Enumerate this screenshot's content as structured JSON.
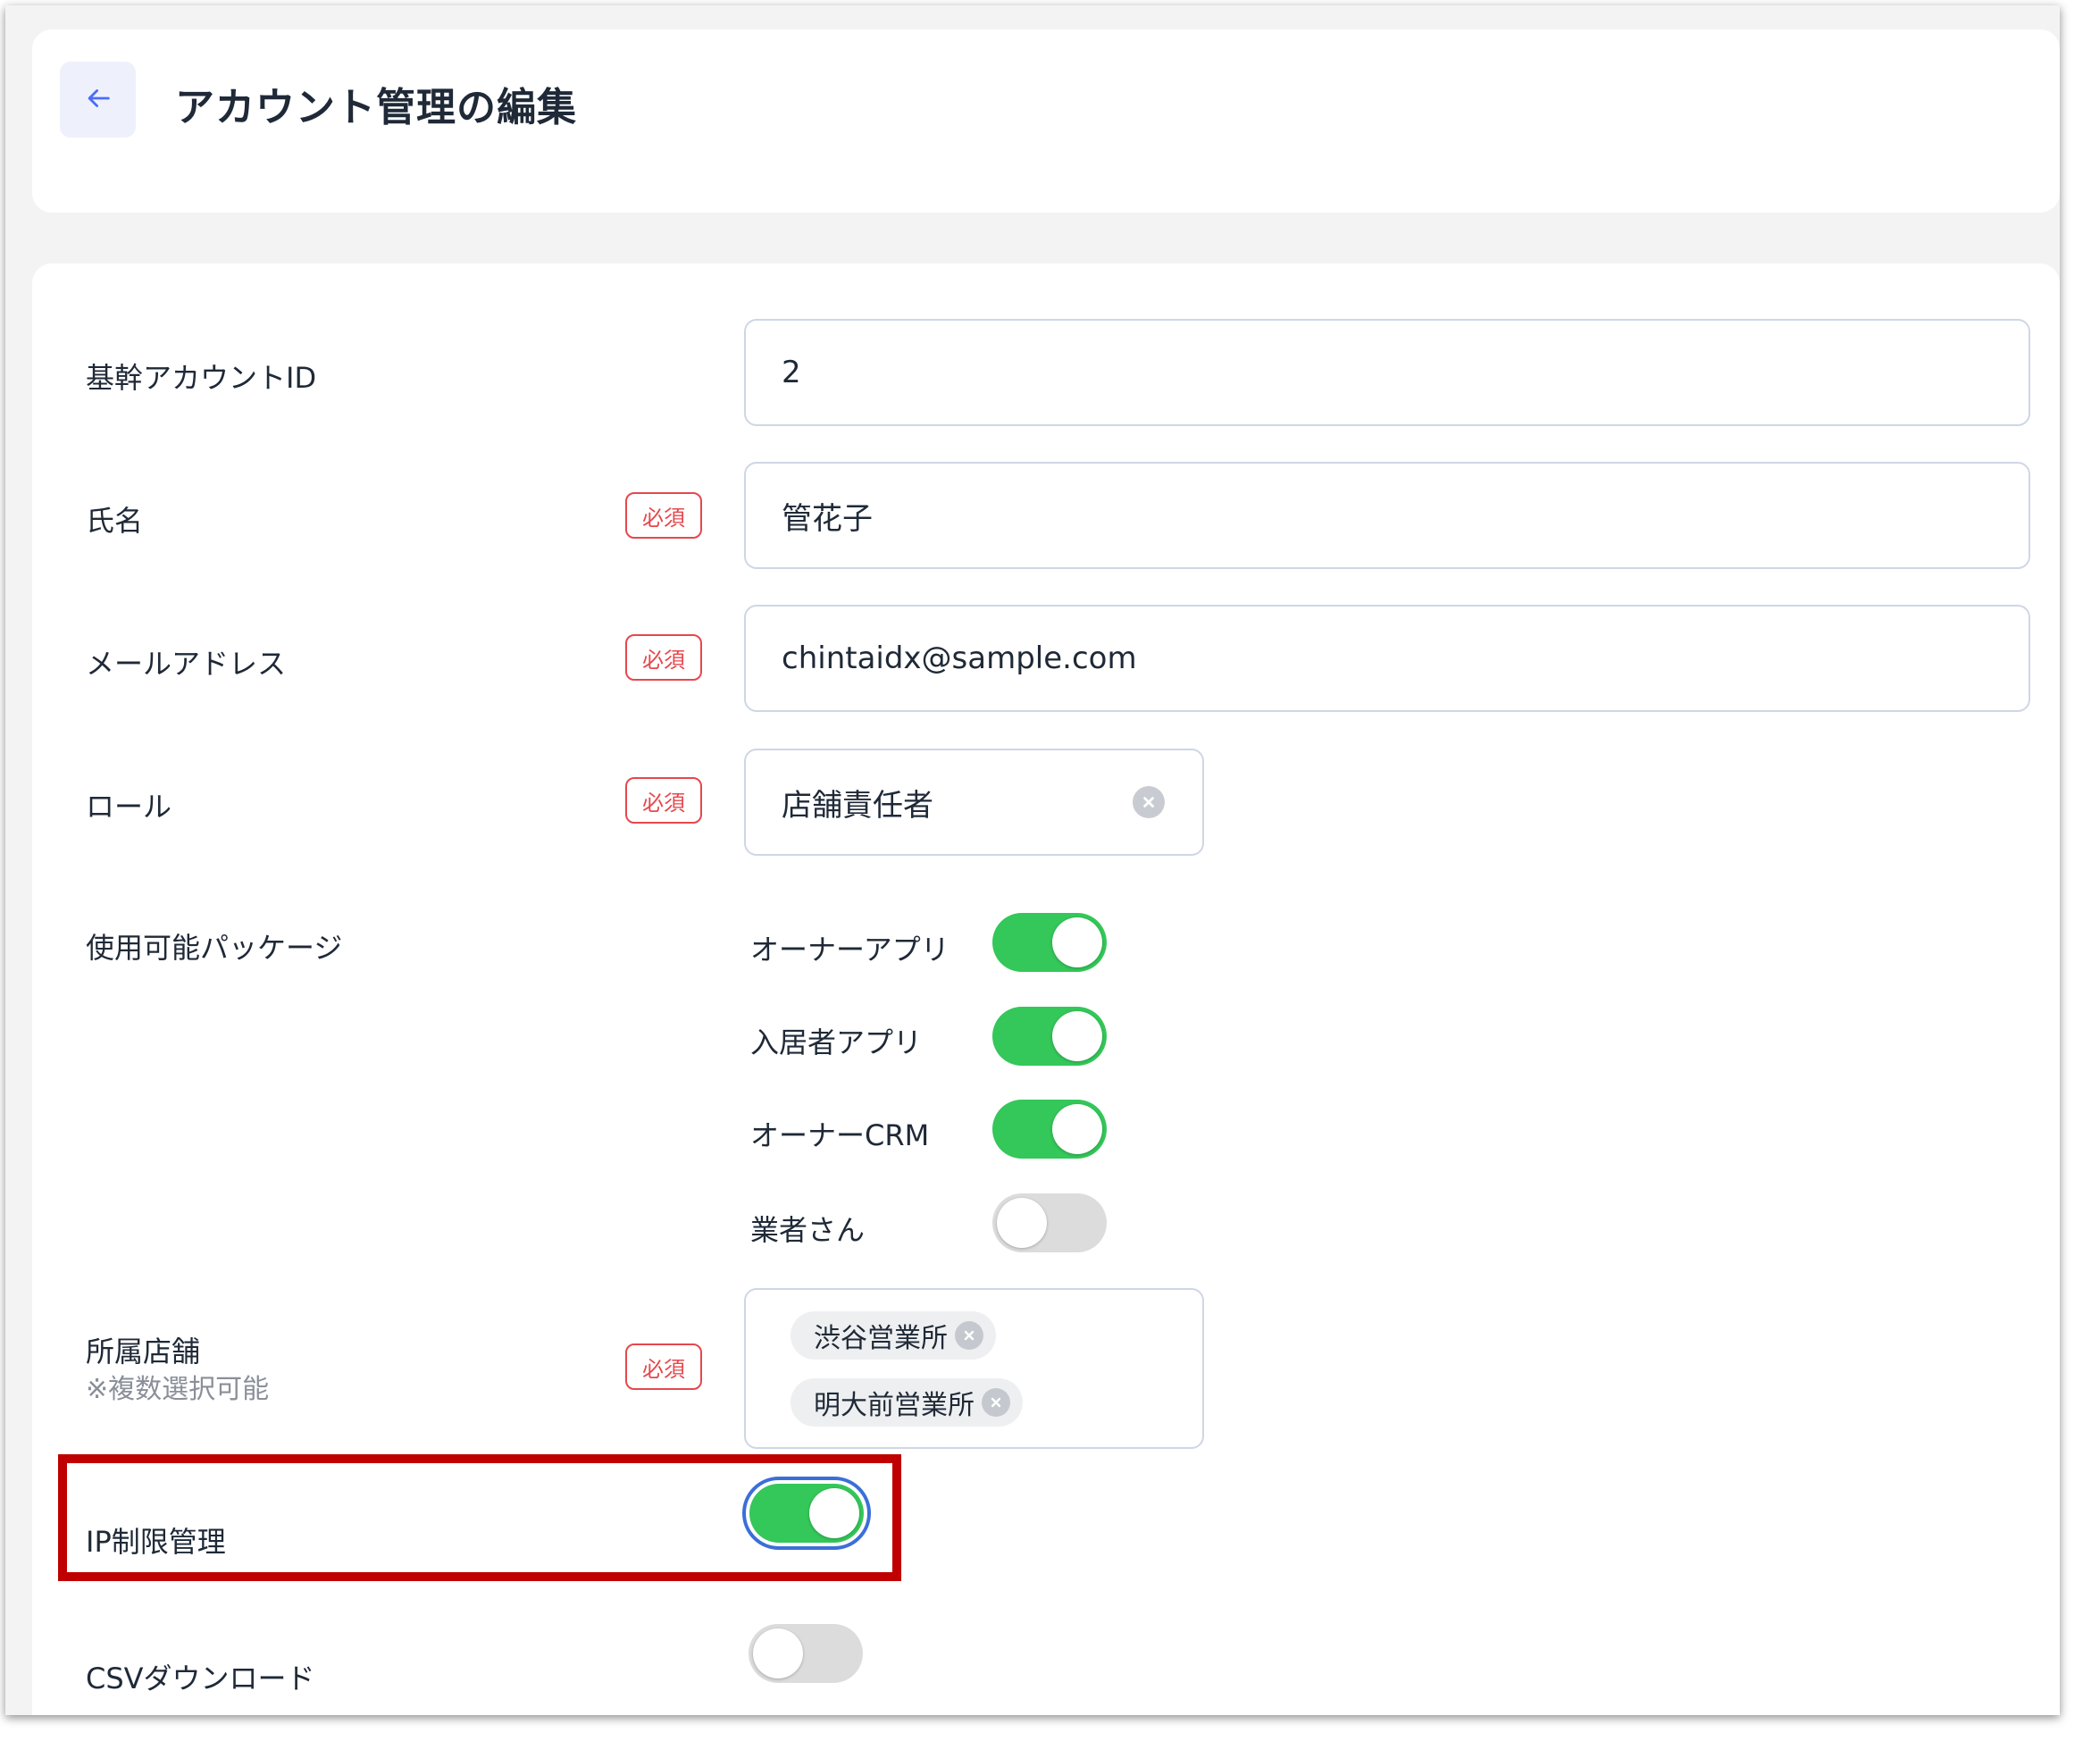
{
  "header": {
    "back_label": "戻る",
    "title": "アカウント管理の編集"
  },
  "form": {
    "required_label": "必須",
    "account_id": {
      "label": "基幹アカウントID",
      "value": "2"
    },
    "name": {
      "label": "氏名",
      "value": "管花子"
    },
    "email": {
      "label": "メールアドレス",
      "value": "chintaidx@sample.com"
    },
    "role": {
      "label": "ロール",
      "value": "店舗責任者"
    },
    "packages": {
      "label": "使用可能パッケージ",
      "items": [
        {
          "label": "オーナーアプリ",
          "enabled": true
        },
        {
          "label": "入居者アプリ",
          "enabled": true
        },
        {
          "label": "オーナーCRM",
          "enabled": true
        },
        {
          "label": "業者さん",
          "enabled": false
        }
      ]
    },
    "stores": {
      "label": "所属店舗",
      "note": "※複数選択可能",
      "tags": [
        "渋谷営業所",
        "明大前営業所"
      ]
    },
    "ip_restriction": {
      "label": "IP制限管理",
      "enabled": true
    },
    "csv_download": {
      "label": "CSVダウンロード",
      "enabled": false
    }
  },
  "colors": {
    "toggle_on": "#34c759",
    "toggle_off": "#dcdcdc",
    "required": "#e5484d",
    "highlight": "#c00000",
    "focus": "#3b6fd8"
  },
  "icons": {
    "back": "arrow-left-icon",
    "clear": "clear-circle-icon"
  }
}
